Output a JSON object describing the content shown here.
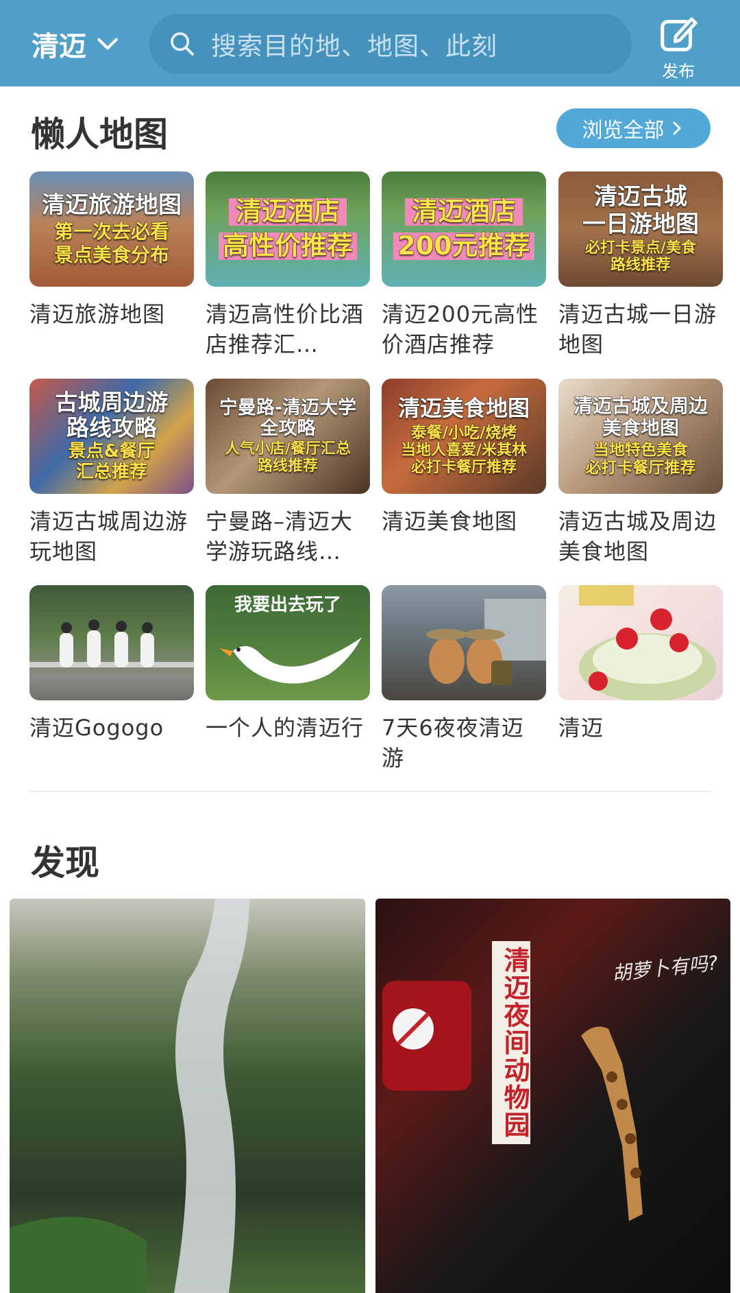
{
  "header": {
    "city": "清迈",
    "search_placeholder": "搜索目的地、地图、此刻",
    "publish_label": "发布",
    "bg_color": "#4f9fc8"
  },
  "lazy_map": {
    "title": "懒人地图",
    "browse_all": "浏览全部",
    "items": [
      {
        "label": "清迈旅游地图",
        "thumb_lines": [
          "清迈旅游地图",
          "第一次去必看",
          "景点美食分布"
        ]
      },
      {
        "label": "清迈高性价比酒店推荐汇…",
        "thumb_lines": [
          "清迈酒店",
          "高性价推荐"
        ]
      },
      {
        "label": "清迈200元高性价酒店推荐",
        "thumb_lines": [
          "清迈酒店",
          "200元推荐"
        ]
      },
      {
        "label": "清迈古城一日游地图",
        "thumb_lines": [
          "清迈古城",
          "一日游地图",
          "必打卡景点/美食",
          "路线推荐"
        ]
      },
      {
        "label": "清迈古城周边游玩地图",
        "thumb_lines": [
          "古城周边游",
          "路线攻略",
          "景点&餐厅",
          "汇总推荐"
        ]
      },
      {
        "label": "宁曼路–清迈大学游玩路线…",
        "thumb_lines": [
          "宁曼路-清迈大学",
          "全攻略",
          "人气小店/餐厅汇总",
          "路线推荐"
        ]
      },
      {
        "label": "清迈美食地图",
        "thumb_lines": [
          "清迈美食地图",
          "泰餐/小吃/烧烤",
          "当地人喜爱/米其林",
          "必打卡餐厅推荐"
        ]
      },
      {
        "label": "清迈古城及周边美食地图",
        "thumb_lines": [
          "清迈古城及周边",
          "美食地图",
          "当地特色美食",
          "必打卡餐厅推荐"
        ]
      },
      {
        "label": "清迈Gogogo",
        "thumb_lines": []
      },
      {
        "label": "一个人的清迈行",
        "thumb_lines": [
          "我要出去玩了"
        ]
      },
      {
        "label": "7天6夜夜清迈游",
        "thumb_lines": []
      },
      {
        "label": "清迈",
        "thumb_lines": []
      }
    ]
  },
  "discover": {
    "title": "发现",
    "posts": [
      {
        "overlay": ""
      },
      {
        "overlay": "清迈夜间动物园",
        "handwriting": "胡萝卜有吗?"
      }
    ]
  }
}
